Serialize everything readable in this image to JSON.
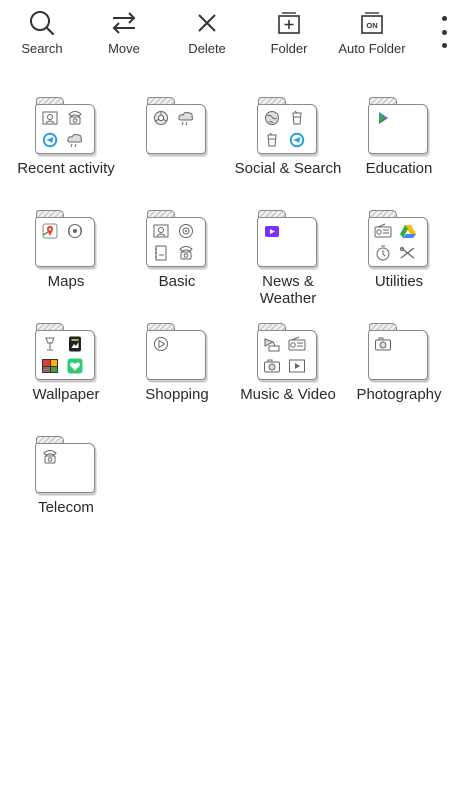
{
  "toolbar": {
    "search_label": "Search",
    "move_label": "Move",
    "delete_label": "Delete",
    "folder_label": "Folder",
    "auto_folder_label": "Auto Folder",
    "auto_folder_badge": "ON"
  },
  "folders": [
    {
      "label": "Recent activity",
      "icons": [
        "contacts-sketch-icon",
        "phone-sketch-icon",
        "telegram-icon",
        "weather-sketch-icon"
      ]
    },
    {
      "label": "",
      "icons": [
        "chrome-sketch-icon",
        "weather-sketch-icon"
      ]
    },
    {
      "label": "Social & Search",
      "icons": [
        "globe-sketch-icon",
        "cup-sketch-icon",
        "cup-sketch-icon",
        "telegram-icon"
      ]
    },
    {
      "label": "Education",
      "icons": [
        "play-store-icon"
      ]
    },
    {
      "label": "Maps",
      "icons": [
        "google-maps-icon",
        "radar-sketch-icon"
      ]
    },
    {
      "label": "Basic",
      "icons": [
        "contacts-sketch-icon",
        "settings-sketch-icon",
        "notes-sketch-icon",
        "phone-sketch-icon"
      ]
    },
    {
      "label": "News &\nWeather",
      "icons": [
        "tv-purple-icon"
      ]
    },
    {
      "label": "Utilities",
      "icons": [
        "radio-sketch-icon",
        "google-drive-icon",
        "clock-sketch-icon",
        "tools-sketch-icon"
      ]
    },
    {
      "label": "Wallpaper",
      "icons": [
        "lamp-sketch-icon",
        "wallpaper-app-icon",
        "photo-grid-icon",
        "green-heart-icon"
      ]
    },
    {
      "label": "Shopping",
      "icons": [
        "play-sketch-icon"
      ]
    },
    {
      "label": "Music & Video",
      "icons": [
        "gramophone-sketch-icon",
        "radio-sketch-icon",
        "camera-sketch-icon",
        "video-sketch-icon"
      ]
    },
    {
      "label": "Photography",
      "icons": [
        "camera-sketch-icon"
      ]
    },
    {
      "label": "Telecom",
      "icons": [
        "phone-sketch-icon"
      ]
    }
  ]
}
